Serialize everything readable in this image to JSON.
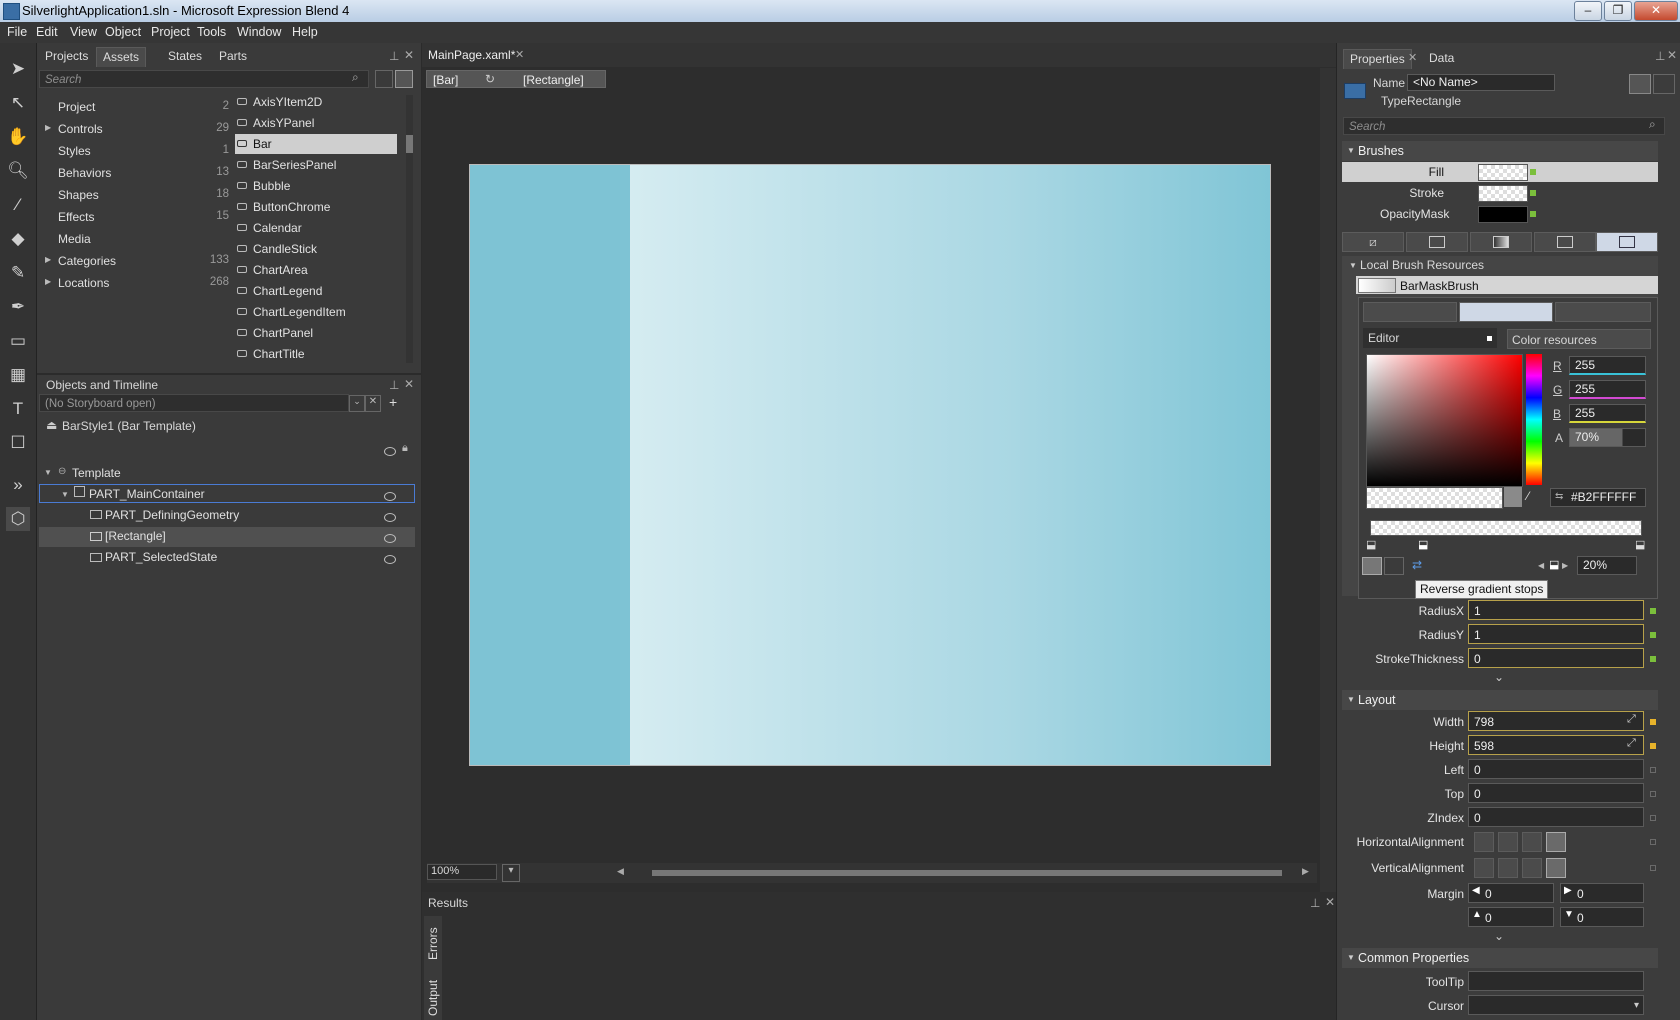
{
  "window": {
    "title": "SilverlightApplication1.sln - Microsoft Expression Blend 4",
    "min": "–",
    "max": "❐",
    "close": "✕"
  },
  "menu": [
    "File",
    "Edit",
    "View",
    "Object",
    "Project",
    "Tools",
    "Window",
    "Help"
  ],
  "assets_panel": {
    "tabs": [
      "Projects",
      "Assets",
      "States",
      "Parts"
    ],
    "search_placeholder": "Search",
    "categories": [
      {
        "label": "Project",
        "count": "2"
      },
      {
        "label": "Controls",
        "count": "29"
      },
      {
        "label": "Styles",
        "count": "1"
      },
      {
        "label": "Behaviors",
        "count": "13"
      },
      {
        "label": "Shapes",
        "count": "18"
      },
      {
        "label": "Effects",
        "count": "15"
      },
      {
        "label": "Media",
        "count": ""
      },
      {
        "label": "Categories",
        "count": "133"
      },
      {
        "label": "Locations",
        "count": "268"
      }
    ],
    "items": [
      "AxisYItem2D",
      "AxisYPanel",
      "Bar",
      "BarSeriesPanel",
      "Bubble",
      "ButtonChrome",
      "Calendar",
      "CandleStick",
      "ChartArea",
      "ChartLegend",
      "ChartLegendItem",
      "ChartPanel",
      "ChartTitle"
    ],
    "selected_item": "Bar"
  },
  "objects_panel": {
    "title": "Objects and Timeline",
    "storyboard": "(No Storyboard open)",
    "scope": "BarStyle1 (Bar Template)",
    "tree": [
      "Template",
      "PART_MainContainer",
      "PART_DefiningGeometry",
      "[Rectangle]",
      "PART_SelectedState"
    ]
  },
  "document": {
    "tab": "MainPage.xaml*",
    "breadcrumb": [
      "[Bar]",
      "[Rectangle]"
    ],
    "zoom": "100%"
  },
  "results": {
    "title": "Results",
    "tabs": [
      "Errors",
      "Output"
    ]
  },
  "properties": {
    "tabs": [
      "Properties",
      "Data"
    ],
    "name_label": "Name",
    "name_value": "<No Name>",
    "type_label": "Type",
    "type_value": "Rectangle",
    "search_placeholder": "Search",
    "brushes_title": "Brushes",
    "fill": "Fill",
    "stroke": "Stroke",
    "opacity_mask": "OpacityMask",
    "local_brush_title": "Local Brush Resources",
    "brush_name": "BarMaskBrush",
    "editor_tab": "Editor",
    "color_resources_tab": "Color resources",
    "r_label": "R",
    "r": "255",
    "g_label": "G",
    "g": "255",
    "b_label": "B",
    "b": "255",
    "a_label": "A",
    "a": "70%",
    "hex": "#B2FFFFFF",
    "stop_offset": "20%",
    "tooltip": "Reverse gradient stops",
    "radiusx_label": "RadiusX",
    "radiusx": "1",
    "radiusy_label": "RadiusY",
    "radiusy": "1",
    "stroke_thickness_label": "StrokeThickness",
    "stroke_thickness": "0",
    "layout_title": "Layout",
    "width_label": "Width",
    "width": "798",
    "height_label": "Height",
    "height": "598",
    "left_label": "Left",
    "left": "0",
    "top_label": "Top",
    "top": "0",
    "zindex_label": "ZIndex",
    "zindex": "0",
    "halign_label": "HorizontalAlignment",
    "valign_label": "VerticalAlignment",
    "margin_label": "Margin",
    "margin": [
      "0",
      "0",
      "0",
      "0"
    ],
    "common_title": "Common Properties",
    "tooltip_label": "ToolTip",
    "cursor_label": "Cursor"
  },
  "colors": {
    "accent": "#3a6ea5",
    "canvas_fill": "#7ec3d4",
    "edited_border": "#b7a14a",
    "local_value_dot": "#7bbf3c"
  }
}
